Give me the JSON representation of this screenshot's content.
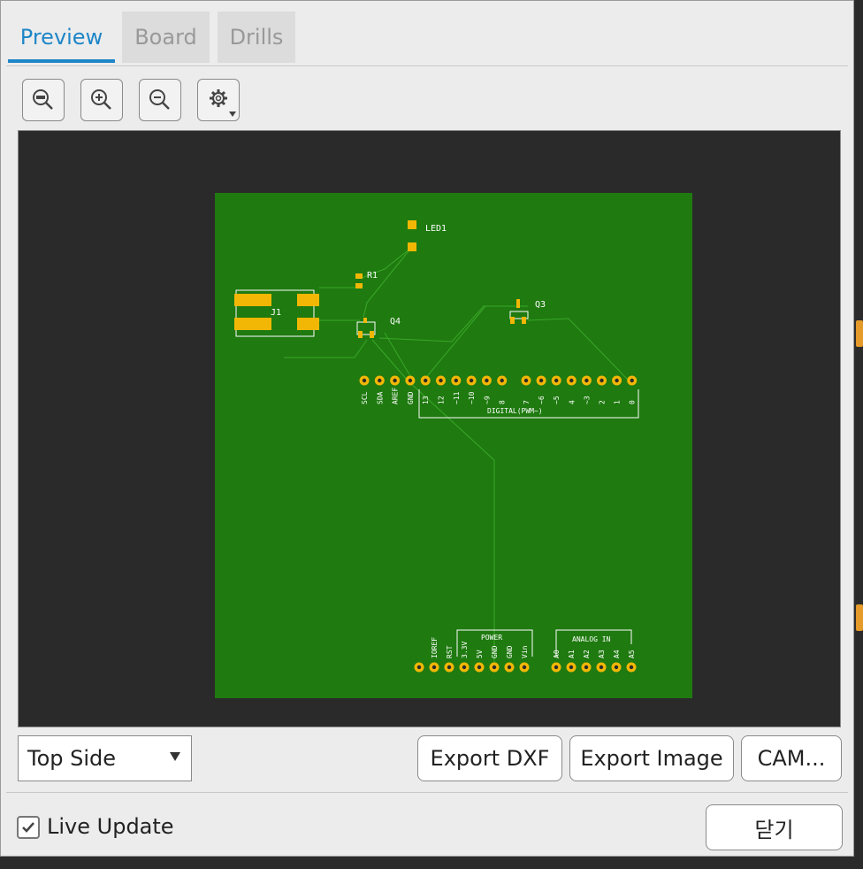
{
  "tabs": [
    {
      "label": "Preview",
      "active": true
    },
    {
      "label": "Board",
      "active": false
    },
    {
      "label": "Drills",
      "active": false
    }
  ],
  "toolbar": {
    "icons": [
      "zoom-fit-icon",
      "zoom-in-icon",
      "zoom-out-icon",
      "gear-icon"
    ]
  },
  "pcb": {
    "board_color": "#1f7a10",
    "pad_color": "#f2b705",
    "silkscreen_color": "#ffffff",
    "refs": {
      "led": "LED1",
      "resistor": "R1",
      "connector": "J1",
      "transistor_q4": "Q4",
      "transistor_q3": "Q3"
    },
    "digital_labels": [
      "SCL",
      "SDA",
      "AREF",
      "GND",
      "13",
      "12",
      "~11",
      "~10",
      "~9",
      "8",
      "7",
      "~6",
      "~5",
      "4",
      "~3",
      "2",
      "1",
      "0"
    ],
    "digital_header": "DIGITAL(PWM~)",
    "power_labels": [
      "IOREF",
      "RST",
      "3.3V",
      "5V",
      "GND",
      "GND",
      "Vin"
    ],
    "power_header": "POWER",
    "analog_labels": [
      "A0",
      "A1",
      "A2",
      "A3",
      "A4",
      "A5"
    ],
    "analog_header": "ANALOG IN"
  },
  "view_select": {
    "value": "Top Side"
  },
  "buttons": {
    "export_dxf": "Export DXF",
    "export_image": "Export Image",
    "cam": "CAM..."
  },
  "live_update": {
    "label": "Live Update",
    "checked": true
  },
  "close_label": "닫기"
}
